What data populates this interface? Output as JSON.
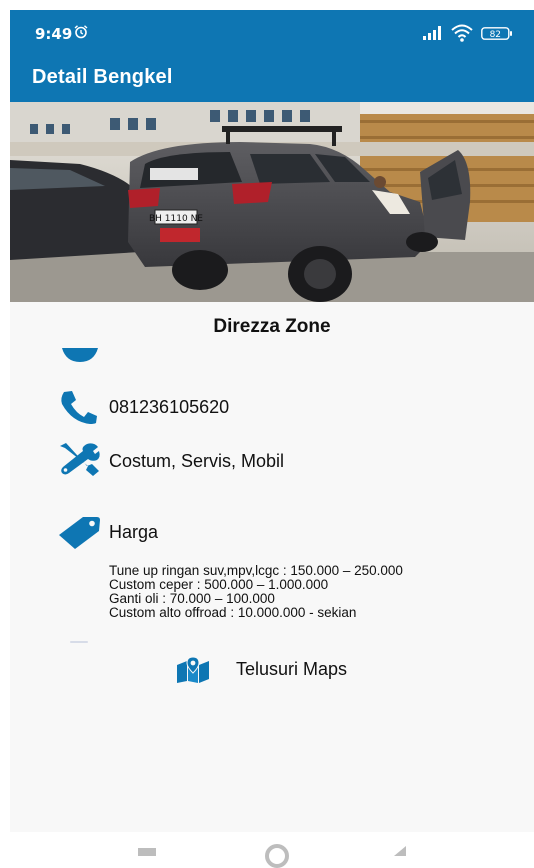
{
  "status_bar": {
    "time": "9:49",
    "battery": "82",
    "icons": [
      "alarm-icon",
      "signal-icon",
      "wifi-icon",
      "battery-icon"
    ]
  },
  "app_bar": {
    "title": "Detail Bengkel"
  },
  "workshop": {
    "name": "Direzza Zone",
    "phone": "081236105620",
    "services": "Costum, Servis, Mobil",
    "price_heading": "Harga",
    "price_list": [
      "Tune up ringan suv,mpv,lcgc : 150.000 – 250.000",
      "Custom ceper  : 500.000 – 1.000.000",
      "Ganti oli : 70.000 – 100.000",
      "Custom alto offroad : 10.000.000  - sekian"
    ],
    "photo_plate": "BH 1110 NE"
  },
  "actions": {
    "maps_label": "Telusuri Maps"
  },
  "colors": {
    "primary": "#0e76b3",
    "icon": "#0e76b3",
    "background": "#f8f8f8",
    "text": "#111111"
  },
  "nav_bar": {
    "items": [
      "recents-square-icon",
      "home-circle-icon",
      "back-triangle-icon"
    ]
  }
}
